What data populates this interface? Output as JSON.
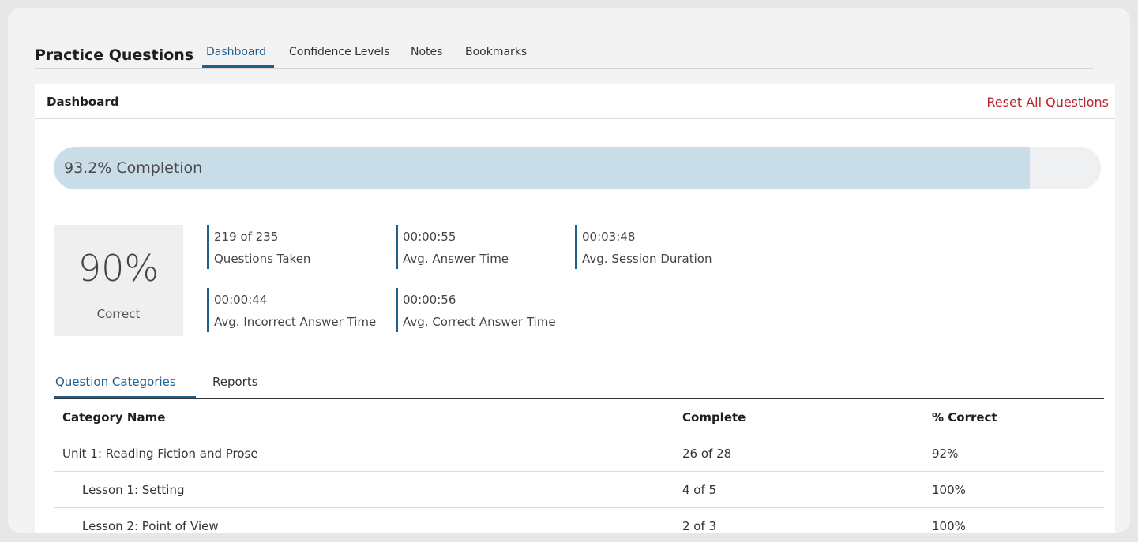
{
  "header": {
    "app_title": "Practice Questions",
    "tabs": [
      {
        "label": "Dashboard",
        "active": true
      },
      {
        "label": "Confidence Levels",
        "active": false
      },
      {
        "label": "Notes",
        "active": false
      },
      {
        "label": "Bookmarks",
        "active": false
      }
    ]
  },
  "panel": {
    "title": "Dashboard",
    "reset_label": "Reset All Questions"
  },
  "progress": {
    "label": "93.2% Completion",
    "percent": 93.2
  },
  "score": {
    "value": "90%",
    "label": "Correct"
  },
  "stats": [
    {
      "value": "219 of 235",
      "label": "Questions Taken"
    },
    {
      "value": "00:00:55",
      "label": "Avg. Answer Time"
    },
    {
      "value": "00:03:48",
      "label": "Avg. Session Duration"
    },
    {
      "value": "00:00:44",
      "label": "Avg. Incorrect Answer Time"
    },
    {
      "value": "00:00:56",
      "label": "Avg. Correct Answer Time"
    }
  ],
  "sub_tabs": [
    {
      "label": "Question Categories",
      "active": true
    },
    {
      "label": "Reports",
      "active": false
    }
  ],
  "table": {
    "columns": [
      "Category Name",
      "Complete",
      "% Correct"
    ],
    "rows": [
      {
        "name": "Unit 1: Reading Fiction and Prose",
        "complete": "26 of 28",
        "correct": "92%"
      },
      {
        "name": "Lesson 1: Setting",
        "complete": "4 of 5",
        "correct": "100%"
      },
      {
        "name": "Lesson 2: Point of View",
        "complete": "2 of 3",
        "correct": "100%"
      }
    ]
  },
  "colors": {
    "accent": "#1f5f8b",
    "danger": "#b8252d",
    "progress_fill": "#c9dde8",
    "progress_track": "#eff0f2"
  }
}
